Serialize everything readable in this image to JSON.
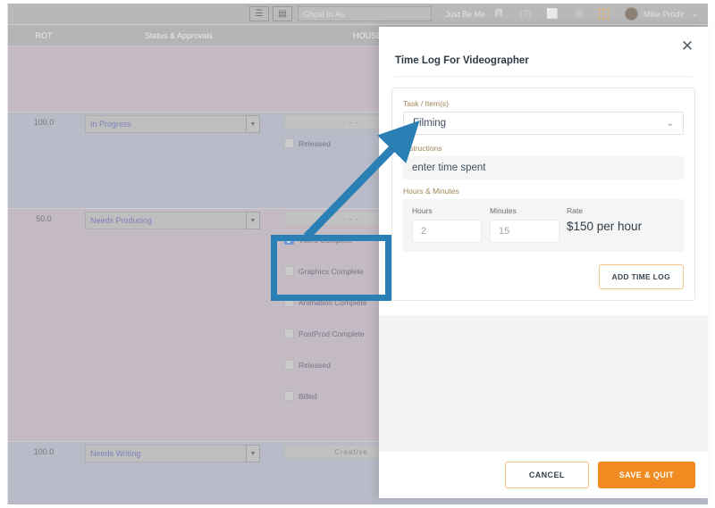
{
  "toolbar": {
    "buttons": [
      {
        "name": "pin-icon",
        "glyph": "☰"
      },
      {
        "name": "calendar-icon",
        "glyph": "▤"
      }
    ],
    "ghost_input_placeholder": "Ghost In As",
    "ghost_input_value": "",
    "just_be_me_label": "Just Be Me",
    "icons": [
      {
        "name": "chat-icon",
        "glyph": "🖪"
      },
      {
        "name": "help-icon",
        "glyph": "?"
      },
      {
        "name": "window-icon",
        "glyph": "⬜"
      },
      {
        "name": "mail-icon",
        "glyph": "✉"
      }
    ],
    "apps_grid_name": "apps-grid-icon",
    "user_name": "Mike Prodir",
    "user_caret": "⌄"
  },
  "grid": {
    "headers": {
      "rot": "ROT",
      "status": "Status & Approvals",
      "house": "HOUSE"
    },
    "rows": [
      {
        "rot": "",
        "status": "",
        "house_field": "",
        "checkboxes": []
      },
      {
        "rot": "100.0",
        "status": "In Progress",
        "house_field": "- - -",
        "checkboxes": [
          {
            "label": "Released",
            "checked": false
          }
        ]
      },
      {
        "rot": "50.0",
        "status": "Needs Producing",
        "house_field": "- - -",
        "checkboxes": [
          {
            "label": "Video Complete",
            "checked": true
          },
          {
            "label": "Graphics Complete",
            "checked": false
          },
          {
            "label": "Animation Complete",
            "checked": false
          },
          {
            "label": "PostProd Complete",
            "checked": false
          },
          {
            "label": "Released",
            "checked": false
          },
          {
            "label": "Billed",
            "checked": false
          }
        ]
      },
      {
        "rot": "100.0",
        "status": "Needs Writing",
        "house_field": "Creative",
        "checkboxes": []
      }
    ]
  },
  "modal": {
    "close_glyph": "✕",
    "title": "Time Log For Videographer",
    "task_label": "Task / Item(s)",
    "task_value": "Filming",
    "task_chevron": "⌄",
    "instructions_label": "Instructions",
    "instructions_value": "enter time spent",
    "hours_minutes_label": "Hours & Minutes",
    "hours_label": "Hours",
    "hours_value": "2",
    "minutes_label": "Minutes",
    "minutes_value": "15",
    "rate_label": "Rate",
    "rate_value": "$150 per hour",
    "add_time_log_label": "ADD TIME LOG",
    "cancel_label": "CANCEL",
    "save_quit_label": "SAVE & QUIT"
  },
  "annotation": {
    "highlight_color": "#2a7fb5",
    "arrow_color": "#2a7fb5",
    "highlight_target": "Video Complete checkbox",
    "arrow_target": "Filming task dropdown"
  },
  "colors": {
    "accent_orange": "#f18b21",
    "annotation_blue": "#2a7fb5",
    "checkbox_checked": "#2f6fc4"
  }
}
